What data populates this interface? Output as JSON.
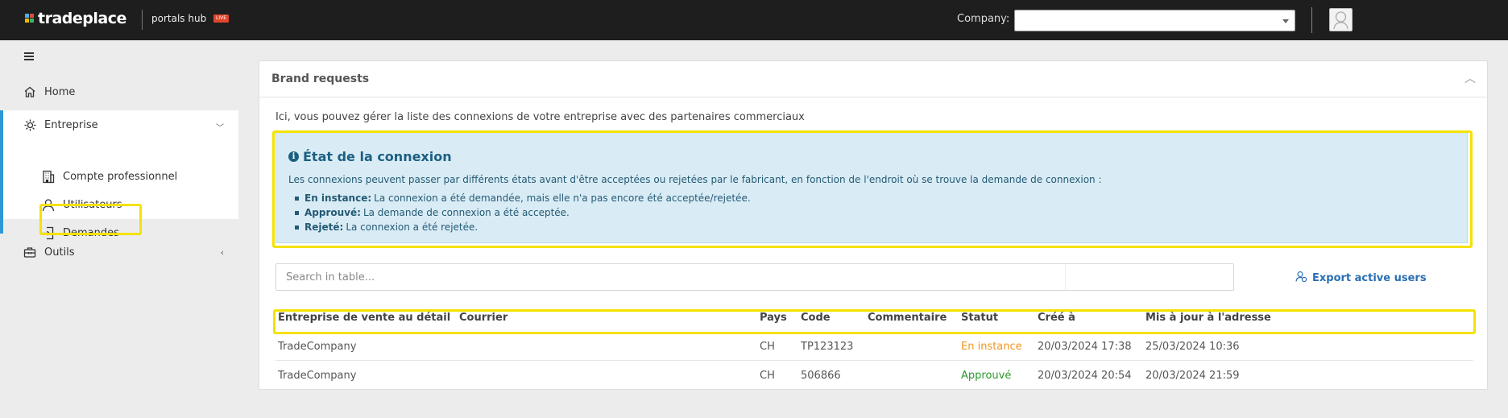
{
  "header": {
    "logo_text": "tradeplace",
    "hub_label": "portals hub",
    "live_badge": "LIVE",
    "company_label": "Company:",
    "company_value": ""
  },
  "sidebar": {
    "home": "Home",
    "entreprise": "Entreprise",
    "sub_items": [
      "Compte professionnel",
      "Utilisateurs",
      "Demandes"
    ],
    "outils": "Outils"
  },
  "card": {
    "title": "Brand requests",
    "intro": "Ici, vous pouvez gérer la liste des connexions de votre entreprise avec des partenaires commerciaux",
    "info": {
      "title": "État de la connexion",
      "description": "Les connexions peuvent passer par différents états avant d'être acceptées ou rejetées par le fabricant, en fonction de l'endroit où se trouve la demande de connexion :",
      "states": [
        {
          "term": "En instance:",
          "text": "La connexion a été demandée, mais elle n'a pas encore été acceptée/rejetée."
        },
        {
          "term": "Approuvé:",
          "text": "La demande de connexion a été acceptée."
        },
        {
          "term": "Rejeté:",
          "text": "La connexion a été rejetée."
        }
      ]
    },
    "search_placeholder": "Search in table...",
    "export_label": "Export active users"
  },
  "table": {
    "columns": [
      "Entreprise de vente au détail",
      "Courrier",
      "Pays",
      "Code",
      "Commentaire",
      "Statut",
      "Créé à",
      "Mis à jour à l'adresse"
    ],
    "rows": [
      {
        "entreprise": "TradeCompany",
        "courrier": "",
        "pays": "CH",
        "code": "TP123123",
        "commentaire": "",
        "statut": "En instance",
        "cree": "20/03/2024 17:38",
        "maj": "25/03/2024 10:36"
      },
      {
        "entreprise": "TradeCompany",
        "courrier": "",
        "pays": "CH",
        "code": "506866",
        "commentaire": "",
        "statut": "Approuvé",
        "cree": "20/03/2024 20:54",
        "maj": "20/03/2024 21:59"
      }
    ]
  },
  "colors": {
    "topbar": "#1e1e1e",
    "accent": "#2e97d6",
    "highlight": "#f4e200",
    "pending": "#f0961e",
    "approved": "#2c9a2c"
  }
}
